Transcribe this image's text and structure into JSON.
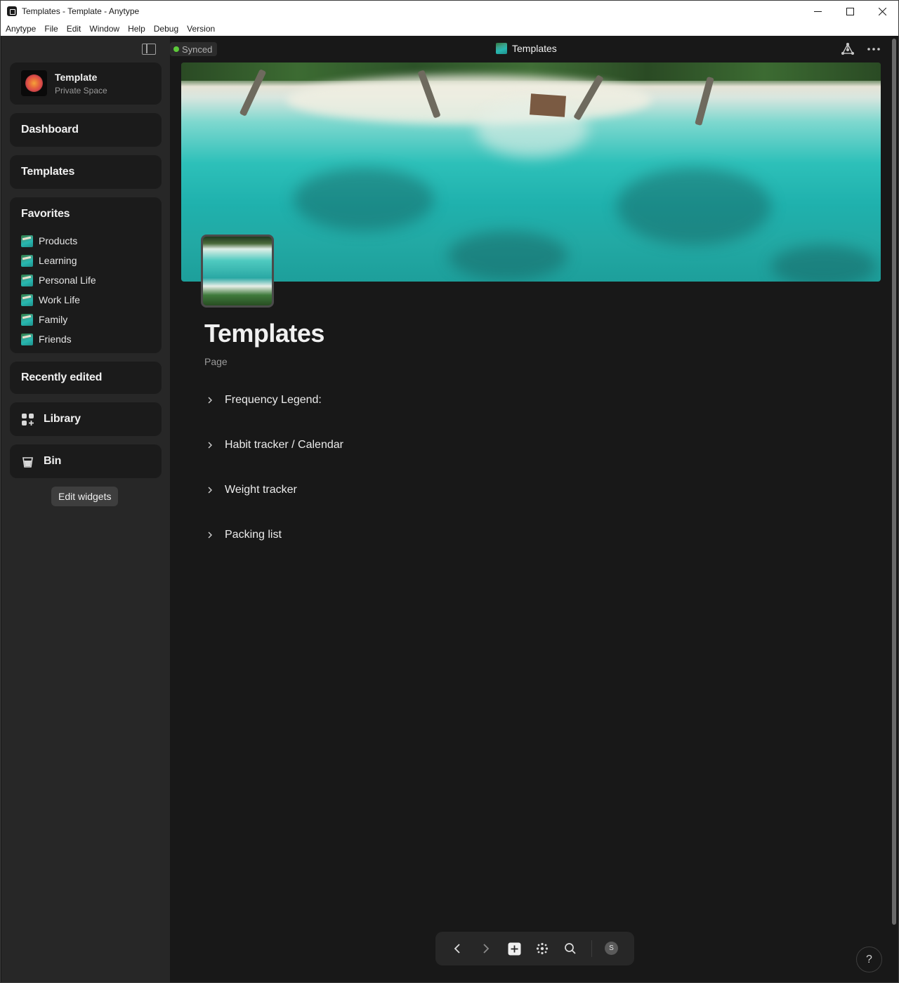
{
  "window": {
    "title": "Templates - Template - Anytype",
    "controls": [
      "minimize-icon",
      "maximize-icon",
      "close-icon"
    ]
  },
  "menubar": {
    "items": [
      "Anytype",
      "File",
      "Edit",
      "Window",
      "Help",
      "Debug",
      "Version"
    ]
  },
  "sidebar": {
    "space": {
      "name": "Template",
      "type": "Private Space"
    },
    "dashboard_label": "Dashboard",
    "templates_label": "Templates",
    "favorites": {
      "title": "Favorites",
      "items": [
        "Products",
        "Learning",
        "Personal Life",
        "Work Life",
        "Family",
        "Friends"
      ]
    },
    "recently_edited_label": "Recently edited",
    "library_label": "Library",
    "bin_label": "Bin",
    "edit_widgets_label": "Edit widgets"
  },
  "header": {
    "sync_status": "Synced",
    "title": "Templates"
  },
  "page": {
    "title": "Templates",
    "type": "Page",
    "toggles": [
      "Frequency Legend:",
      "Habit tracker / Calendar",
      "Weight tracker",
      "Packing list"
    ]
  },
  "navbar": {
    "buttons": [
      "back-icon",
      "forward-icon",
      "plus-icon",
      "graph-icon",
      "search-icon"
    ],
    "avatar_letter": "S"
  },
  "help": {
    "label": "?"
  },
  "colors": {
    "background": "#181818",
    "sidebar": "#272727",
    "widget": "#1b1b1b",
    "sync_dot": "#5cc93a",
    "text": "#f0f0f0",
    "muted_text": "#9a9a9a"
  }
}
